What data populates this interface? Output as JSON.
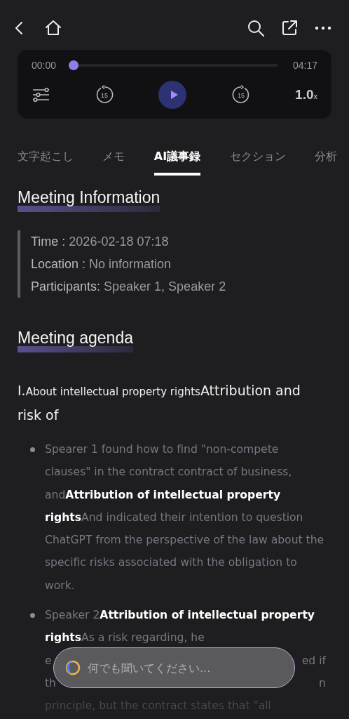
{
  "player": {
    "current_time": "00:00",
    "total_time": "04:17",
    "level": 0,
    "speed": "1.0",
    "speed_unit": "x",
    "rewind_label": "15",
    "forward_label": "15"
  },
  "tabs": [
    {
      "label": "文字起こし",
      "selected": false
    },
    {
      "label": "メモ",
      "selected": false
    },
    {
      "label": "AI議事録",
      "selected": true
    },
    {
      "label": "セクション",
      "selected": false
    },
    {
      "label": "分析",
      "selected": false
    }
  ],
  "meeting_information": {
    "heading": "Meeting Information",
    "fields": [
      {
        "label": "Time :",
        "value": "2026-02-18 07:18"
      },
      {
        "label": "Location :",
        "value": "No information"
      },
      {
        "label": "Participants:",
        "value": "Speaker 1, Speaker 2"
      }
    ]
  },
  "meeting_agenda": {
    "heading": "Meeting agenda",
    "item_title": [
      {
        "text": "I.",
        "kind": "large"
      },
      {
        "text": "About intellectual property rights",
        "kind": "small"
      },
      {
        "text": "Attribution and risk of",
        "kind": "large"
      }
    ],
    "bullets": [
      {
        "text": "Spearer 1 found how to find \"non-compete clauses\" in the contract contract of business, and**Attribution of intellectual property rights**And indicated their intention to question ChatGPT from the perspective of the law about the specific risks associated with the obligation to work."
      },
      {
        "text": "Speaker 2**Attribution of intellectual property rights**As a risk regarding, he",
        "fragments": [
          {
            "left": "e",
            "right": "ed if"
          },
          {
            "left": "th",
            "right": "n"
          }
        ],
        "last_line": "principle, but the contract states that \"all"
      }
    ]
  },
  "ask_field": {
    "placeholder": "何でも聞いてください..."
  }
}
